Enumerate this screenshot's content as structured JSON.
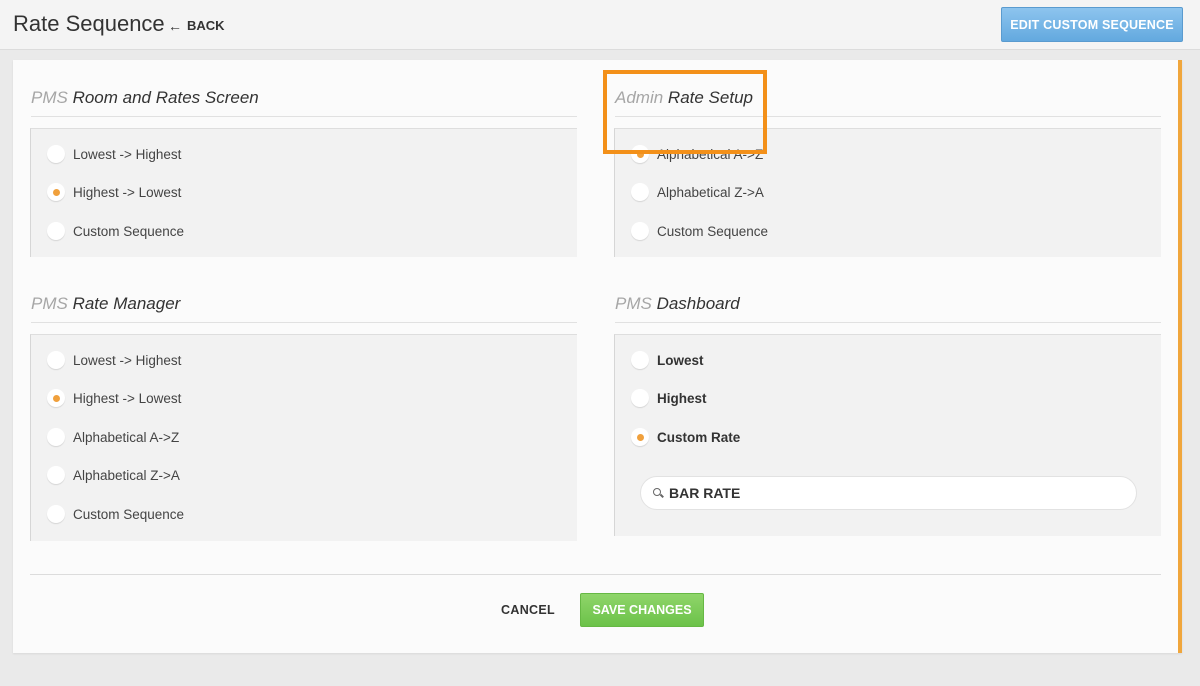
{
  "header": {
    "title": "Rate Sequence",
    "back_label": "BACK",
    "edit_button": "EDIT CUSTOM SEQUENCE"
  },
  "sections": {
    "room_rates": {
      "prefix": "PMS",
      "title": "Room and Rates Screen",
      "options": [
        "Lowest -> Highest",
        "Highest -> Lowest",
        "Custom Sequence"
      ],
      "selected": 1
    },
    "admin_rate_setup": {
      "prefix": "Admin",
      "title": "Rate Setup",
      "options": [
        "Alphabetical A->Z",
        "Alphabetical Z->A",
        "Custom Sequence"
      ],
      "selected": 0
    },
    "rate_manager": {
      "prefix": "PMS",
      "title": "Rate Manager",
      "options": [
        "Lowest -> Highest",
        "Highest -> Lowest",
        "Alphabetical A->Z",
        "Alphabetical Z->A",
        "Custom Sequence"
      ],
      "selected": 1
    },
    "dashboard": {
      "prefix": "PMS",
      "title": "Dashboard",
      "options": [
        "Lowest",
        "Highest",
        "Custom Rate"
      ],
      "selected": 2,
      "search_value": "BAR RATE"
    }
  },
  "footer": {
    "cancel_label": "CANCEL",
    "save_label": "SAVE CHANGES"
  },
  "colors": {
    "accent": "#f0a03c",
    "highlight": "#f39019",
    "edit_button": "#6aaee2",
    "save_button": "#74c84f"
  },
  "icons": {
    "back": "left-arrow-icon",
    "search": "search-icon"
  }
}
